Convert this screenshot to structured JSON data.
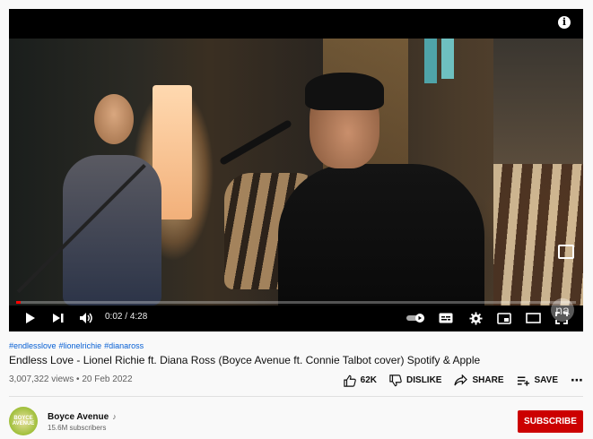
{
  "player": {
    "info_glyph": "i",
    "watermark_text": "na",
    "progress_fraction": 0.008,
    "time_current": "0:02",
    "time_separator": " / ",
    "time_total": "4:28",
    "icons": [
      "play-icon",
      "next-icon",
      "volume-icon",
      "autoplay-toggle-icon",
      "subtitles-icon",
      "settings-icon",
      "miniplayer-icon",
      "theater-mode-icon",
      "fullscreen-icon",
      "info-icon",
      "pip-icon"
    ]
  },
  "video": {
    "hashtags": [
      "#endlesslove",
      "#lionelrichie",
      "#dianaross"
    ],
    "title": "Endless Love - Lionel Richie ft. Diana Ross (Boyce Avenue ft. Connie Talbot cover) Spotify & Apple",
    "views": "3,007,322 views",
    "separator": " • ",
    "date": "20 Feb 2022"
  },
  "actions": {
    "like_count": "62K",
    "dislike_label": "DISLIKE",
    "share_label": "SHARE",
    "save_label": "SAVE",
    "more_glyph": "⋯"
  },
  "channel": {
    "avatar_text": "BOYCE AVENUE",
    "name": "Boyce Avenue",
    "verified_glyph": "♪",
    "subscribers": "15.6M subscribers"
  },
  "subscribe": {
    "label": "SUBSCRIBE"
  },
  "colors": {
    "accent_red": "#cc0000",
    "progress_red": "#ff0000",
    "link_blue": "#065fd4"
  }
}
